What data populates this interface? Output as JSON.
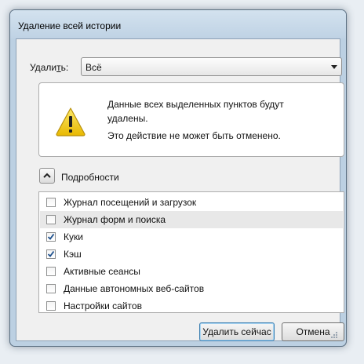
{
  "window": {
    "title": "Удаление всей истории"
  },
  "scope": {
    "label_prefix": "Удали",
    "label_accel": "т",
    "label_suffix": "ь:",
    "selected": "Всё"
  },
  "warning": {
    "icon": "warning-triangle-icon",
    "line1": "Данные всех выделенных пунктов будут удалены.",
    "line2": "Это действие не может быть отменено."
  },
  "details": {
    "label": "Подробности",
    "expanded": true
  },
  "items": [
    {
      "label": "Журнал посещений и загрузок",
      "checked": false
    },
    {
      "label": "Журнал форм и поиска",
      "checked": false,
      "hover": true
    },
    {
      "label": "Куки",
      "checked": true
    },
    {
      "label": "Кэш",
      "checked": true
    },
    {
      "label": "Активные сеансы",
      "checked": false
    },
    {
      "label": "Данные автономных веб-сайтов",
      "checked": false
    },
    {
      "label": "Настройки сайтов",
      "checked": false
    }
  ],
  "buttons": {
    "clear": "Удалить сейчас",
    "cancel": "Отмена"
  },
  "colors": {
    "accent": "#3c7fb1",
    "checkmark": "#1c4f8c",
    "warning": "#f5d020"
  }
}
